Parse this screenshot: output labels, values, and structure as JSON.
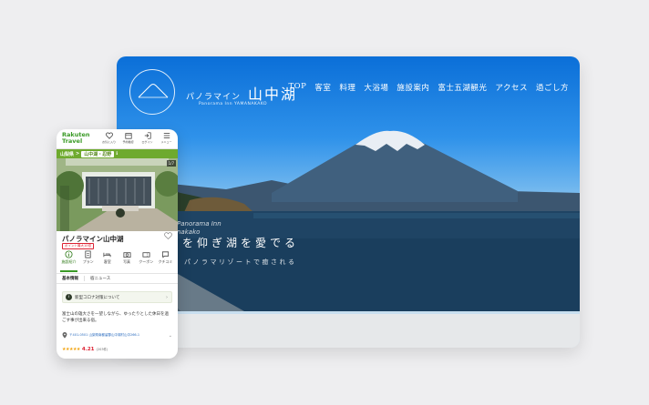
{
  "desktop": {
    "brand_small": "パノラマイン",
    "brand_large": "山中湖",
    "brand_sub": "Panorama Inn YAMANAKAKO",
    "nav": [
      "TOP",
      "客室",
      "料理",
      "大浴場",
      "施設案内",
      "富士五湖観光",
      "アクセス",
      "過ごし方"
    ],
    "hero_en_1": "Panorama Inn",
    "hero_en_2": "nakako",
    "hero_copy": "を仰ぎ湖を愛でる",
    "hero_sub": "パノラマリゾートで癒される"
  },
  "mobile": {
    "logo_line1": "Rakuten",
    "logo_line2": "Travel",
    "header_icons": [
      {
        "icon": "heart-icon",
        "label": "お気に入り"
      },
      {
        "icon": "calendar-icon",
        "label": "予約確認"
      },
      {
        "icon": "login-icon",
        "label": "ログイン"
      },
      {
        "icon": "menu-icon",
        "label": "メニュー"
      }
    ],
    "breadcrumb": [
      "山梨県",
      ">",
      "山中湖・忍野",
      "ℹ"
    ],
    "photo_count": "1/7",
    "hotel_name": "パノラマイン山中湖",
    "tag": "ポイント最大10倍",
    "tabs": [
      {
        "icon": "info-icon",
        "label": "施設紹介"
      },
      {
        "icon": "document-icon",
        "label": "プラン"
      },
      {
        "icon": "bed-icon",
        "label": "客室"
      },
      {
        "icon": "camera-icon",
        "label": "写真"
      },
      {
        "icon": "coupon-icon",
        "label": "クーポン"
      },
      {
        "icon": "chat-icon",
        "label": "クチコミ"
      }
    ],
    "sub_tabs": [
      "基本情報",
      "宿ニュース"
    ],
    "notice": "新型コロナ対策について",
    "description": "富士山の雄大さを一望しながら、ゆったりとした休日を過ごす事が出来る宿。",
    "address": "〒401-0501 山梨県南都留郡山中湖村山中266-1",
    "stars": "★★★★★",
    "score": "4.21",
    "reviews": "(203件)"
  },
  "colors": {
    "rakuten_green": "#3a9a26",
    "breadcrumb_green": "#6eaa2e",
    "score_red": "#dd2233",
    "star_orange": "#f2a30f"
  }
}
